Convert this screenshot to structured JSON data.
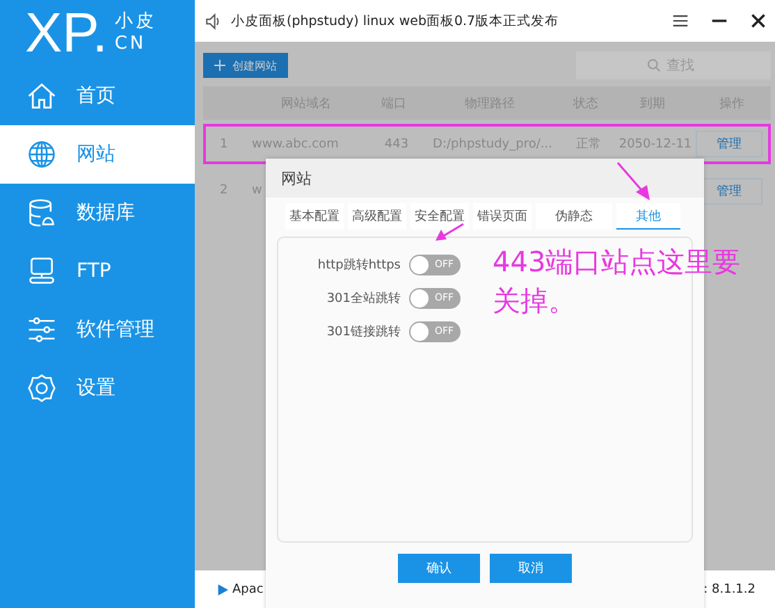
{
  "window": {
    "title": "小皮面板(phpstudy) linux web面板0.7版本正式发布"
  },
  "logo": {
    "mark": "XP.",
    "name": "小皮",
    "domain": "CN"
  },
  "sidebar": {
    "items": [
      {
        "label": "首页",
        "selected": false
      },
      {
        "label": "网站",
        "selected": true
      },
      {
        "label": "数据库",
        "selected": false
      },
      {
        "label": "FTP",
        "selected": false
      },
      {
        "label": "软件管理",
        "selected": false
      },
      {
        "label": "设置",
        "selected": false
      }
    ]
  },
  "toolbar": {
    "create_button": "创建网站",
    "search": {
      "placeholder": "查找"
    }
  },
  "table": {
    "columns": [
      "",
      "网站域名",
      "端口",
      "物理路径",
      "状态",
      "到期",
      "操作"
    ],
    "rows": [
      {
        "cells": [
          "1",
          "www.abc.com",
          "443",
          "D:/phpstudy_pro/...",
          "正常",
          "2050-12-11"
        ],
        "action": "管理",
        "highlighted": true
      },
      {
        "cells": [
          "2",
          "w"
        ],
        "action": "管理",
        "highlighted": false
      }
    ]
  },
  "dialog": {
    "title": "网站",
    "tabs": [
      {
        "label": "基本配置",
        "selected": false
      },
      {
        "label": "高级配置",
        "selected": false
      },
      {
        "label": "安全配置",
        "selected": false
      },
      {
        "label": "错误页面",
        "selected": false
      },
      {
        "label": "伪静态",
        "selected": false
      },
      {
        "label": "其他",
        "selected": true
      }
    ],
    "settings": [
      {
        "label": "http跳转https",
        "on": false,
        "state_text": "OFF"
      },
      {
        "label": "301全站跳转",
        "on": false,
        "state_text": "OFF"
      },
      {
        "label": "301链接跳转",
        "on": false,
        "state_text": "OFF"
      }
    ],
    "buttons": [
      "确认",
      "取消"
    ]
  },
  "annotation": {
    "text": "443端口站点这里要关掉。"
  },
  "status_bar": {
    "left": "Apac",
    "right": ": 8.1.1.2"
  }
}
